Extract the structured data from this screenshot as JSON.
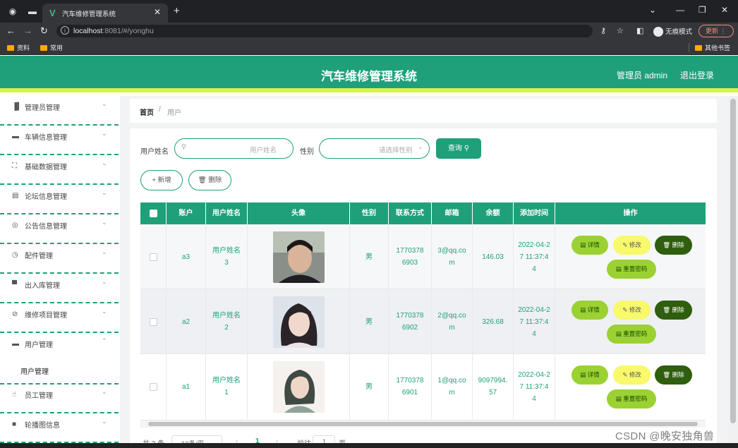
{
  "browser": {
    "tab_title": "汽车维修管理系统",
    "url_host": "localhost",
    "url_path": ":8081/#/yonghu",
    "incognito_label": "无痕模式",
    "update_label": "更新",
    "bookmarks": [
      "资料",
      "常用"
    ],
    "other_bookmarks": "其他书签"
  },
  "header": {
    "title": "汽车维修管理系统",
    "admin": "管理员 admin",
    "logout": "退出登录"
  },
  "sidebar": {
    "items": [
      {
        "label": "管理员管理",
        "icon": "bar-chart-icon"
      },
      {
        "label": "车辆信息管理",
        "icon": "briefcase-icon"
      },
      {
        "label": "基础数据管理",
        "icon": "fullscreen-icon"
      },
      {
        "label": "论坛信息管理",
        "icon": "clipboard-icon"
      },
      {
        "label": "公告信息管理",
        "icon": "compass-icon"
      },
      {
        "label": "配件管理",
        "icon": "clock-icon"
      },
      {
        "label": "出入库管理",
        "icon": "monitor-icon"
      },
      {
        "label": "维修项目管理",
        "icon": "no-signal-icon"
      },
      {
        "label": "用户管理",
        "icon": "message-icon"
      },
      {
        "label": "员工管理",
        "icon": "thumb-up-icon"
      },
      {
        "label": "轮播图信息",
        "icon": "camera-icon"
      }
    ],
    "sub_item": "用户管理"
  },
  "breadcrumb": {
    "home": "首页",
    "separator": "/",
    "current": "用户"
  },
  "search": {
    "name_label": "用户姓名",
    "name_placeholder": "用户姓名",
    "gender_label": "性别",
    "gender_placeholder": "请选择性别",
    "query_button": "查询"
  },
  "actions": {
    "add": "新增",
    "delete": "删除"
  },
  "table": {
    "columns": [
      "账户",
      "用户姓名",
      "头像",
      "性别",
      "联系方式",
      "邮箱",
      "余额",
      "添加时间",
      "操作"
    ],
    "rows": [
      {
        "account": "a3",
        "name": "用户姓名3",
        "gender": "男",
        "phone": "17703786903",
        "email": "3@qq.com",
        "balance": "146.03",
        "time": "2022-04-27 11:37:44"
      },
      {
        "account": "a2",
        "name": "用户姓名2",
        "gender": "男",
        "phone": "17703786902",
        "email": "2@qq.com",
        "balance": "326.68",
        "time": "2022-04-27 11:37:44"
      },
      {
        "account": "a1",
        "name": "用户姓名1",
        "gender": "男",
        "phone": "17703786901",
        "email": "1@qq.com",
        "balance": "9097994.57",
        "time": "2022-04-27 11:37:44"
      }
    ],
    "buttons": {
      "detail": "详情",
      "edit": "修改",
      "delete": "删除",
      "reset": "重置密码"
    }
  },
  "pagination": {
    "total": "共 3 条",
    "page_size": "10条/页",
    "current_page": "1",
    "goto": "前往",
    "goto_value": "1",
    "page_unit": "页"
  },
  "watermark": "CSDN @晚安独角兽",
  "colors": {
    "primary": "#1fa07a",
    "accent_bar": "#d4f545",
    "detail": "#9bd132",
    "edit": "#f8f96b",
    "delete": "#2e5e0e"
  }
}
